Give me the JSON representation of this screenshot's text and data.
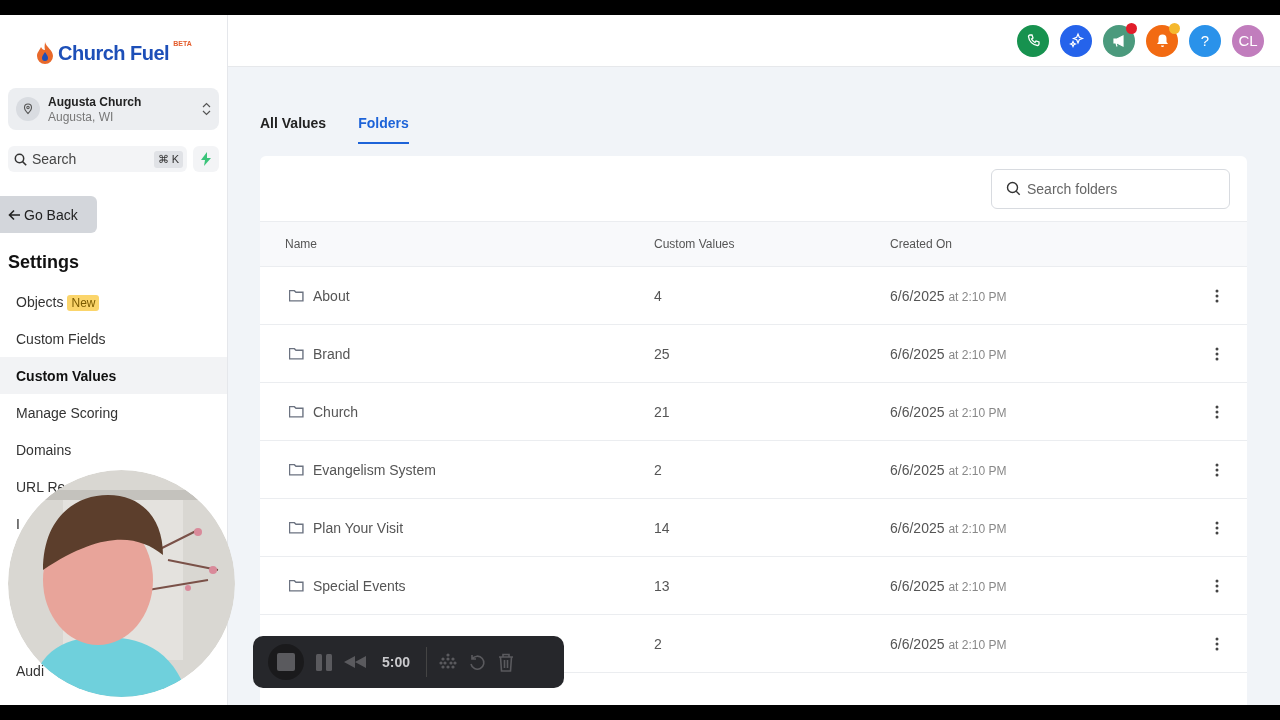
{
  "brand": {
    "name": "Church Fuel",
    "badge": "BETA"
  },
  "location": {
    "name": "Augusta Church",
    "sub": "Augusta, WI"
  },
  "search": {
    "placeholder": "Search",
    "shortcut": "⌘ K"
  },
  "back_button": "Go Back",
  "settings_title": "Settings",
  "menu": [
    {
      "label": "Objects",
      "badge": "New",
      "selected": false
    },
    {
      "label": "Custom Fields",
      "selected": false
    },
    {
      "label": "Custom Values",
      "selected": true
    },
    {
      "label": "Manage Scoring",
      "selected": false
    },
    {
      "label": "Domains",
      "selected": false
    },
    {
      "label": "URL Re",
      "selected": false
    },
    {
      "label": "I",
      "selected": false
    },
    {
      "label": "Audi",
      "selected": false
    }
  ],
  "header_buttons": [
    {
      "kind": "phone",
      "color": "#17924f"
    },
    {
      "kind": "sparkle",
      "color": "#2563eb"
    },
    {
      "kind": "megaphone",
      "color": "#4b9a7d",
      "dot": {
        "color": "#e11d2a"
      }
    },
    {
      "kind": "bell",
      "color": "#f26a12",
      "dot": {
        "color": "#f5b82e"
      }
    },
    {
      "kind": "help",
      "color": "#2a92ea",
      "text": "?"
    },
    {
      "kind": "avatar",
      "color": "#c17dbd",
      "text": "CL"
    }
  ],
  "tabs": [
    {
      "label": "All Values",
      "selected": false
    },
    {
      "label": "Folders",
      "selected": true
    }
  ],
  "table": {
    "search": {
      "placeholder": "Search folders"
    },
    "columns": [
      "Name",
      "Custom Values",
      "Created On"
    ],
    "rows": [
      {
        "name": "About",
        "count": "4",
        "date": "6/6/2025",
        "time": "at 2:10 PM"
      },
      {
        "name": "Brand",
        "count": "25",
        "date": "6/6/2025",
        "time": "at 2:10 PM"
      },
      {
        "name": "Church",
        "count": "21",
        "date": "6/6/2025",
        "time": "at 2:10 PM"
      },
      {
        "name": "Evangelism System",
        "count": "2",
        "date": "6/6/2025",
        "time": "at 2:10 PM"
      },
      {
        "name": "Plan Your Visit",
        "count": "14",
        "date": "6/6/2025",
        "time": "at 2:10 PM"
      },
      {
        "name": "Special Events",
        "count": "13",
        "date": "6/6/2025",
        "time": "at 2:10 PM"
      },
      {
        "count": "2",
        "date": "6/6/2025",
        "time": "at 2:10 PM"
      }
    ]
  },
  "recorder": {
    "timer": "5:00"
  }
}
